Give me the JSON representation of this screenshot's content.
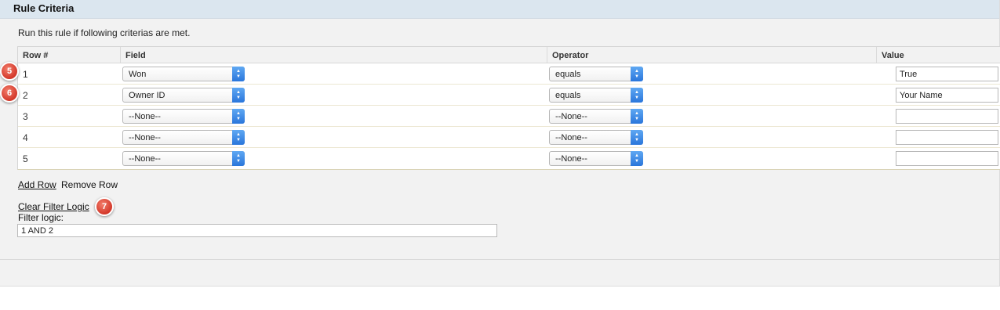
{
  "section": {
    "title": "Rule Criteria",
    "intro": "Run this rule if following criterias are met."
  },
  "criteria": {
    "columns": {
      "row": "Row #",
      "field": "Field",
      "operator": "Operator",
      "value": "Value"
    },
    "rows": [
      {
        "num": "1",
        "field": "Won",
        "operator": "equals",
        "value": "True",
        "badge": "5"
      },
      {
        "num": "2",
        "field": "Owner ID",
        "operator": "equals",
        "value": "Your Name",
        "badge": "6"
      },
      {
        "num": "3",
        "field": "--None--",
        "operator": "--None--",
        "value": ""
      },
      {
        "num": "4",
        "field": "--None--",
        "operator": "--None--",
        "value": ""
      },
      {
        "num": "5",
        "field": "--None--",
        "operator": "--None--",
        "value": ""
      }
    ]
  },
  "actions": {
    "add_row": "Add Row",
    "remove_row": "Remove Row"
  },
  "filter": {
    "clear_link": "Clear Filter Logic",
    "label": "Filter logic:",
    "value": "1 AND 2",
    "badge": "7"
  },
  "icons": {
    "select_arrow": "updown-arrows-icon"
  },
  "colors": {
    "header_bg": "#dbe6ef",
    "panel_bg": "#f2f2f2",
    "badge": "#d3382a",
    "select_arrow": "#2a76db"
  }
}
